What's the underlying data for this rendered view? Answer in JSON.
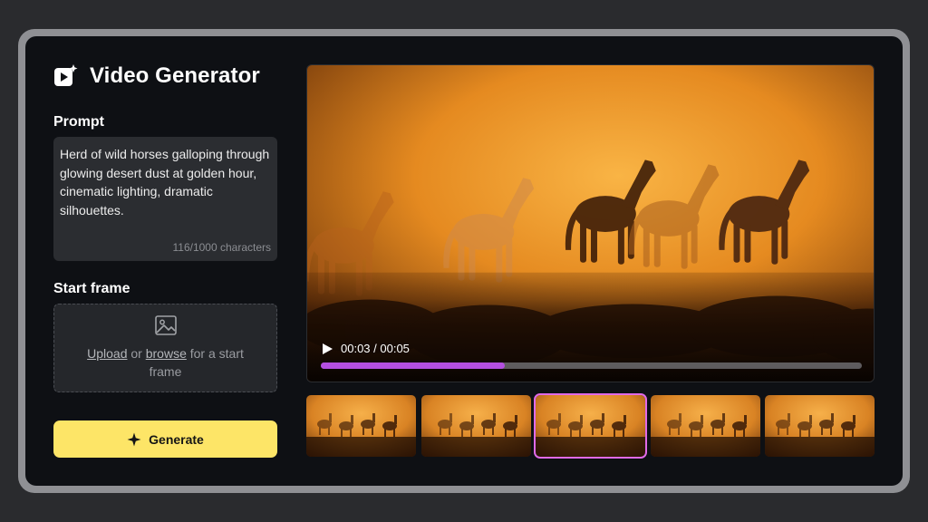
{
  "app": {
    "title": "Video Generator"
  },
  "prompt": {
    "label": "Prompt",
    "value": "Herd of wild horses galloping through glowing desert dust at golden hour, cinematic lighting, dramatic silhouettes.",
    "count": "116/1000 characters"
  },
  "start_frame": {
    "label": "Start frame",
    "upload_link": "Upload",
    "middle": " or ",
    "browse_link": "browse",
    "tail": " for a start frame"
  },
  "generate": {
    "label": "Generate"
  },
  "player": {
    "time": "00:03 / 00:05",
    "progress": 0.34
  },
  "thumbnails": {
    "count": 5,
    "selected_index": 2
  },
  "colors": {
    "accent": "#fde567",
    "progress": "#b34fe0",
    "selected_border": "#e06ae8",
    "background": "#0e1014"
  }
}
